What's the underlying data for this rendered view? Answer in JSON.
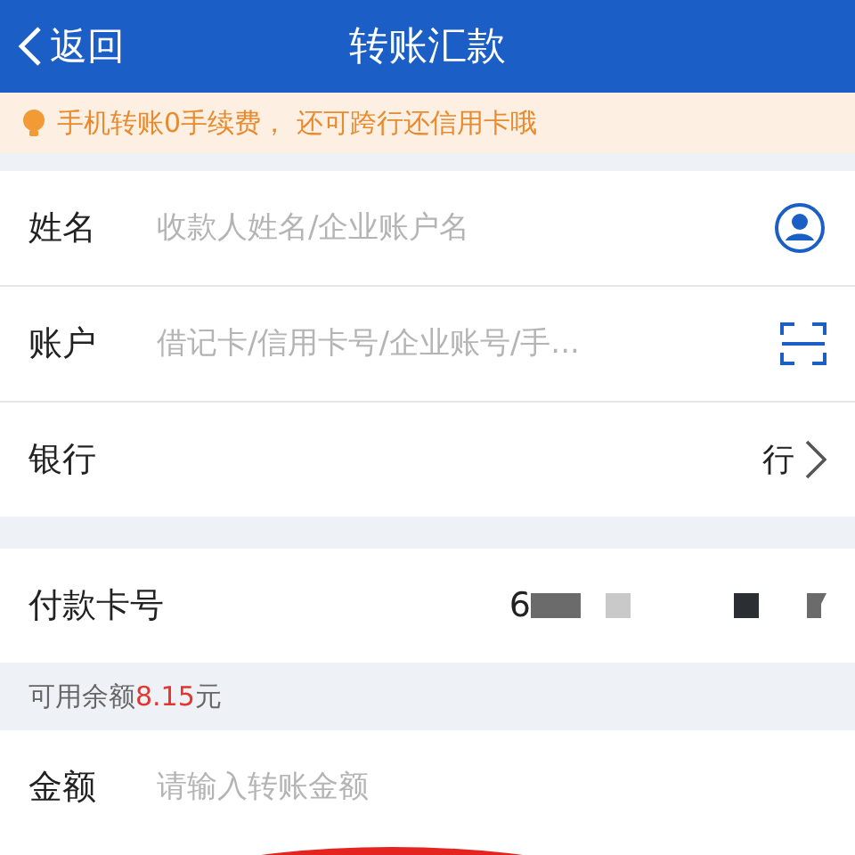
{
  "header": {
    "back": "返回",
    "title": "转账汇款"
  },
  "notice": "手机转账0手续费， 还可跨行还信用卡哦",
  "payee": [
    {
      "kind": "name",
      "label": "姓名",
      "placeholder": "收款人姓名/企业账户名"
    },
    {
      "kind": "account",
      "label": "账户",
      "placeholder": "借记卡/信用卡号/企业账号/手..."
    },
    {
      "kind": "bank",
      "label": "银行",
      "value": "行"
    }
  ],
  "payment": {
    "label": "付款卡号",
    "value": "6"
  },
  "balance": "可用余额**8.15**元",
  "amount": {
    "label": "金额",
    "placeholder": "请输入转账金额"
  }
}
